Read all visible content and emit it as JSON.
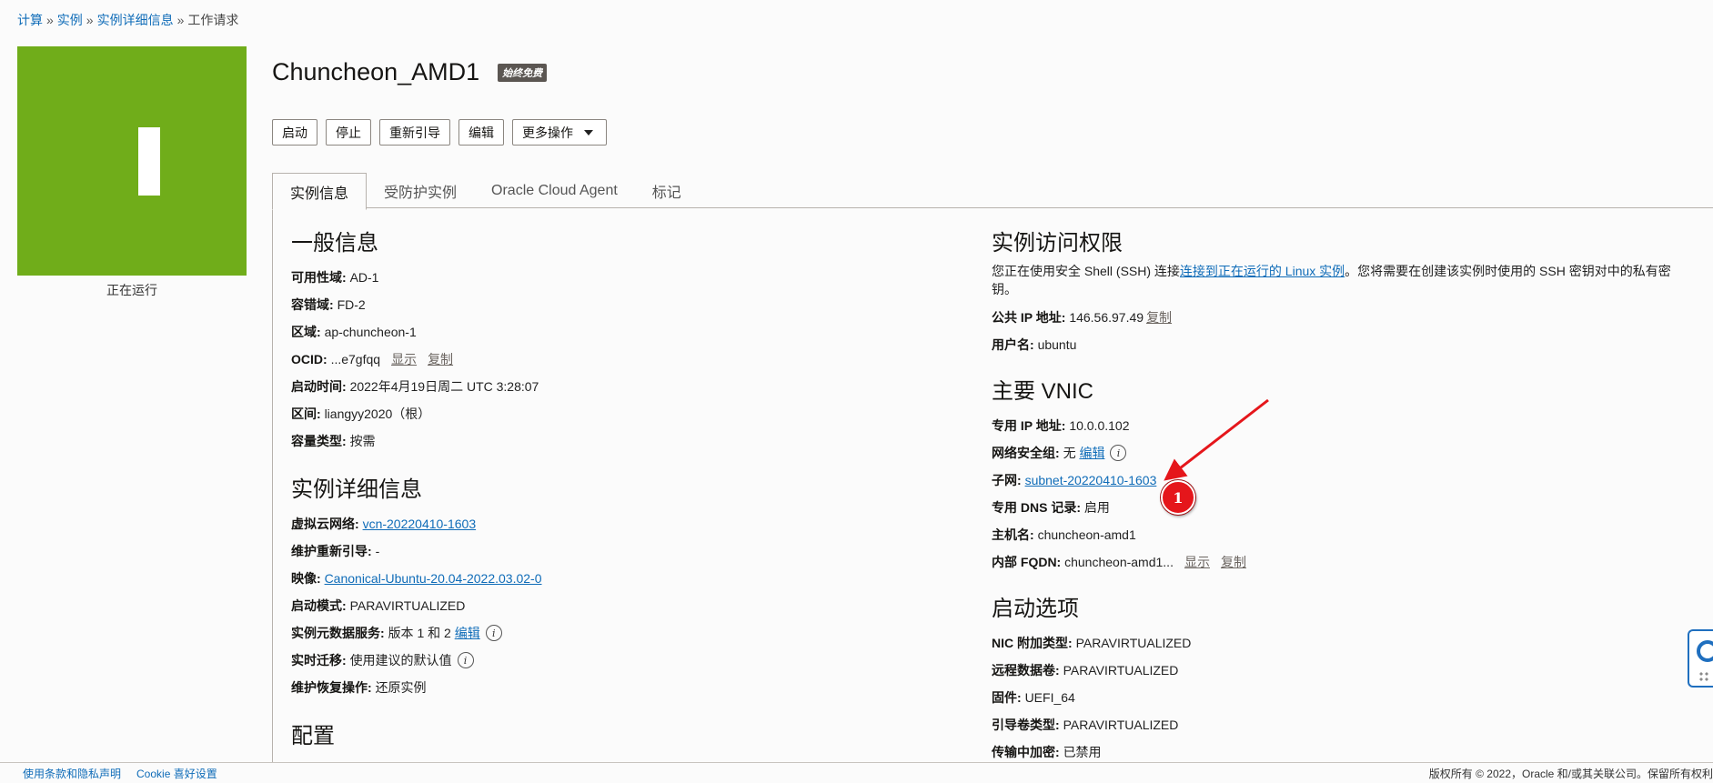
{
  "breadcrumb": {
    "items": [
      "计算",
      "实例",
      "实例详细信息"
    ],
    "sep": "»",
    "current": "工作请求"
  },
  "status_tile": {
    "letter_icon": "running-status-icon",
    "status": "正在运行",
    "color": "#70ad1a"
  },
  "instance": {
    "name": "Chuncheon_AMD1",
    "badge": "始终免费"
  },
  "actions": {
    "start": "启动",
    "stop": "停止",
    "reboot": "重新引导",
    "edit": "编辑",
    "more": "更多操作"
  },
  "tabs": [
    "实例信息",
    "受防护实例",
    "Oracle Cloud Agent",
    "标记"
  ],
  "general": {
    "heading": "一般信息",
    "ad_label": "可用性域:",
    "ad_value": "AD-1",
    "fd_label": "容错域:",
    "fd_value": "FD-2",
    "region_label": "区域:",
    "region_value": "ap-chuncheon-1",
    "ocid_label": "OCID:",
    "ocid_value": "...e7gfqq",
    "show": "显示",
    "copy": "复制",
    "launched_label": "启动时间:",
    "launched_value": "2022年4月19日周二 UTC 3:28:07",
    "compartment_label": "区间:",
    "compartment_value": "liangyy2020（根）",
    "capacity_label": "容量类型:",
    "capacity_value": "按需"
  },
  "details": {
    "heading": "实例详细信息",
    "vcn_label": "虚拟云网络:",
    "vcn_value": "vcn-20220410-1603",
    "maint_reboot_label": "维护重新引导:",
    "maint_reboot_value": "-",
    "image_label": "映像:",
    "image_value": "Canonical-Ubuntu-20.04-2022.03.02-0",
    "launch_mode_label": "启动模式:",
    "launch_mode_value": "PARAVIRTUALIZED",
    "metadata_label": "实例元数据服务:",
    "metadata_value": "版本 1 和 2",
    "metadata_edit": "编辑",
    "live_migration_label": "实时迁移:",
    "live_migration_value": "使用建议的默认值",
    "recovery_label": "维护恢复操作:",
    "recovery_value": "还原实例"
  },
  "config": {
    "heading": "配置"
  },
  "access": {
    "heading": "实例访问权限",
    "text_before": "您正在使用安全 Shell (SSH) 连接",
    "link_text": "连接到正在运行的 Linux 实例",
    "text_after": "。您将需要在创建该实例时使用的 SSH 密钥对中的私有密",
    "text_line2": "钥。",
    "public_ip_label": "公共 IP 地址:",
    "public_ip_value": "146.56.97.49",
    "copy": "复制",
    "username_label": "用户名:",
    "username_value": "ubuntu"
  },
  "vnic": {
    "heading": "主要 VNIC",
    "private_ip_label": "专用 IP 地址:",
    "private_ip_value": "10.0.0.102",
    "nsg_label": "网络安全组:",
    "nsg_value": "无",
    "nsg_edit": "编辑",
    "subnet_label": "子网:",
    "subnet_value": "subnet-20220410-1603",
    "dns_label": "专用 DNS 记录:",
    "dns_value": "启用",
    "hostname_label": "主机名:",
    "hostname_value": "chuncheon-amd1",
    "fqdn_label": "内部 FQDN:",
    "fqdn_value": "chuncheon-amd1...",
    "show": "显示",
    "copy": "复制"
  },
  "launch_options": {
    "heading": "启动选项",
    "nic_label": "NIC 附加类型:",
    "nic_value": "PARAVIRTUALIZED",
    "remote_vol_label": "远程数据卷:",
    "remote_vol_value": "PARAVIRTUALIZED",
    "firmware_label": "固件:",
    "firmware_value": "UEFI_64",
    "boot_vol_label": "引导卷类型:",
    "boot_vol_value": "PARAVIRTUALIZED",
    "encryption_label": "传输中加密:",
    "encryption_value": "已禁用"
  },
  "annotation": {
    "number": "1",
    "color": "#e5161b"
  },
  "footer": {
    "terms": "使用条款和隐私声明",
    "cookies": "Cookie 喜好设置",
    "copyright": "版权所有 © 2022，Oracle 和/或其关联公司。保留所有权利"
  },
  "colors": {
    "link": "#0f6cb8",
    "tile": "#70ad1a",
    "help_widget": "#1f6fbf"
  }
}
